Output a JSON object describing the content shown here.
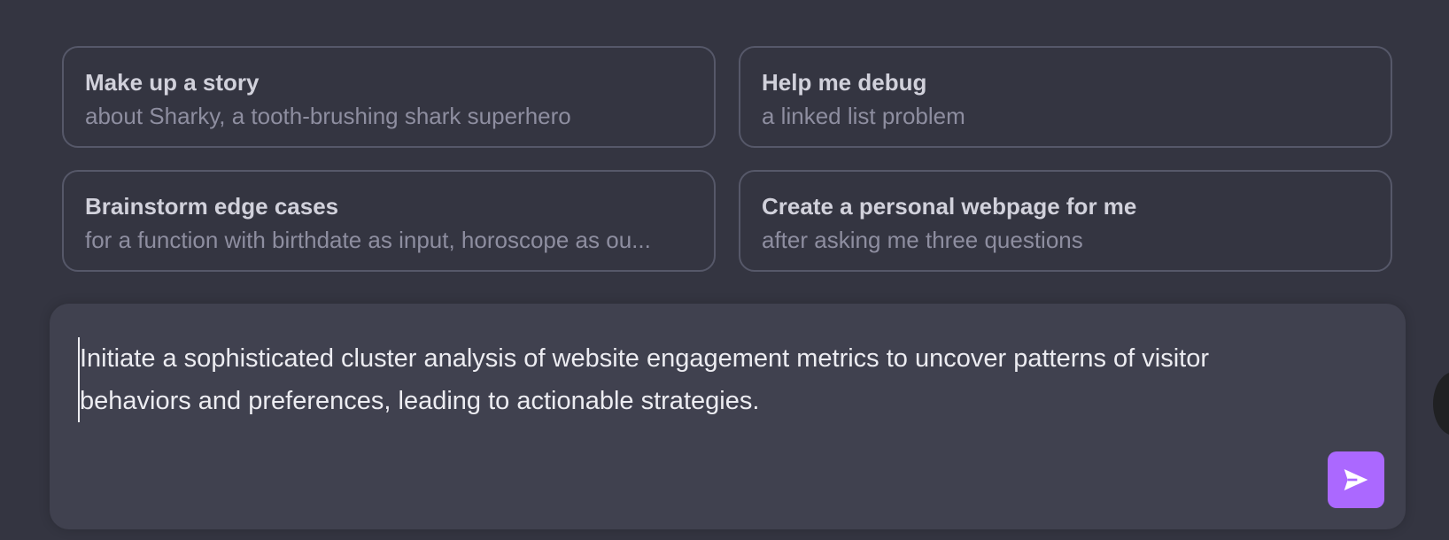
{
  "suggestions": [
    {
      "title": "Make up a story",
      "subtitle": "about Sharky, a tooth-brushing shark superhero"
    },
    {
      "title": "Help me debug",
      "subtitle": "a linked list problem"
    },
    {
      "title": "Brainstorm edge cases",
      "subtitle": "for a function with birthdate as input, horoscope as ou..."
    },
    {
      "title": "Create a personal webpage for me",
      "subtitle": "after asking me three questions"
    }
  ],
  "composer": {
    "text": "Initiate a sophisticated cluster analysis of website engagement metrics to uncover patterns of visitor behaviors and preferences, leading to actionable strategies.",
    "send_icon": "paper-plane-icon"
  },
  "colors": {
    "background": "#343541",
    "card_border": "#565869",
    "composer_bg": "#40414f",
    "send_button": "#ab68ff"
  }
}
